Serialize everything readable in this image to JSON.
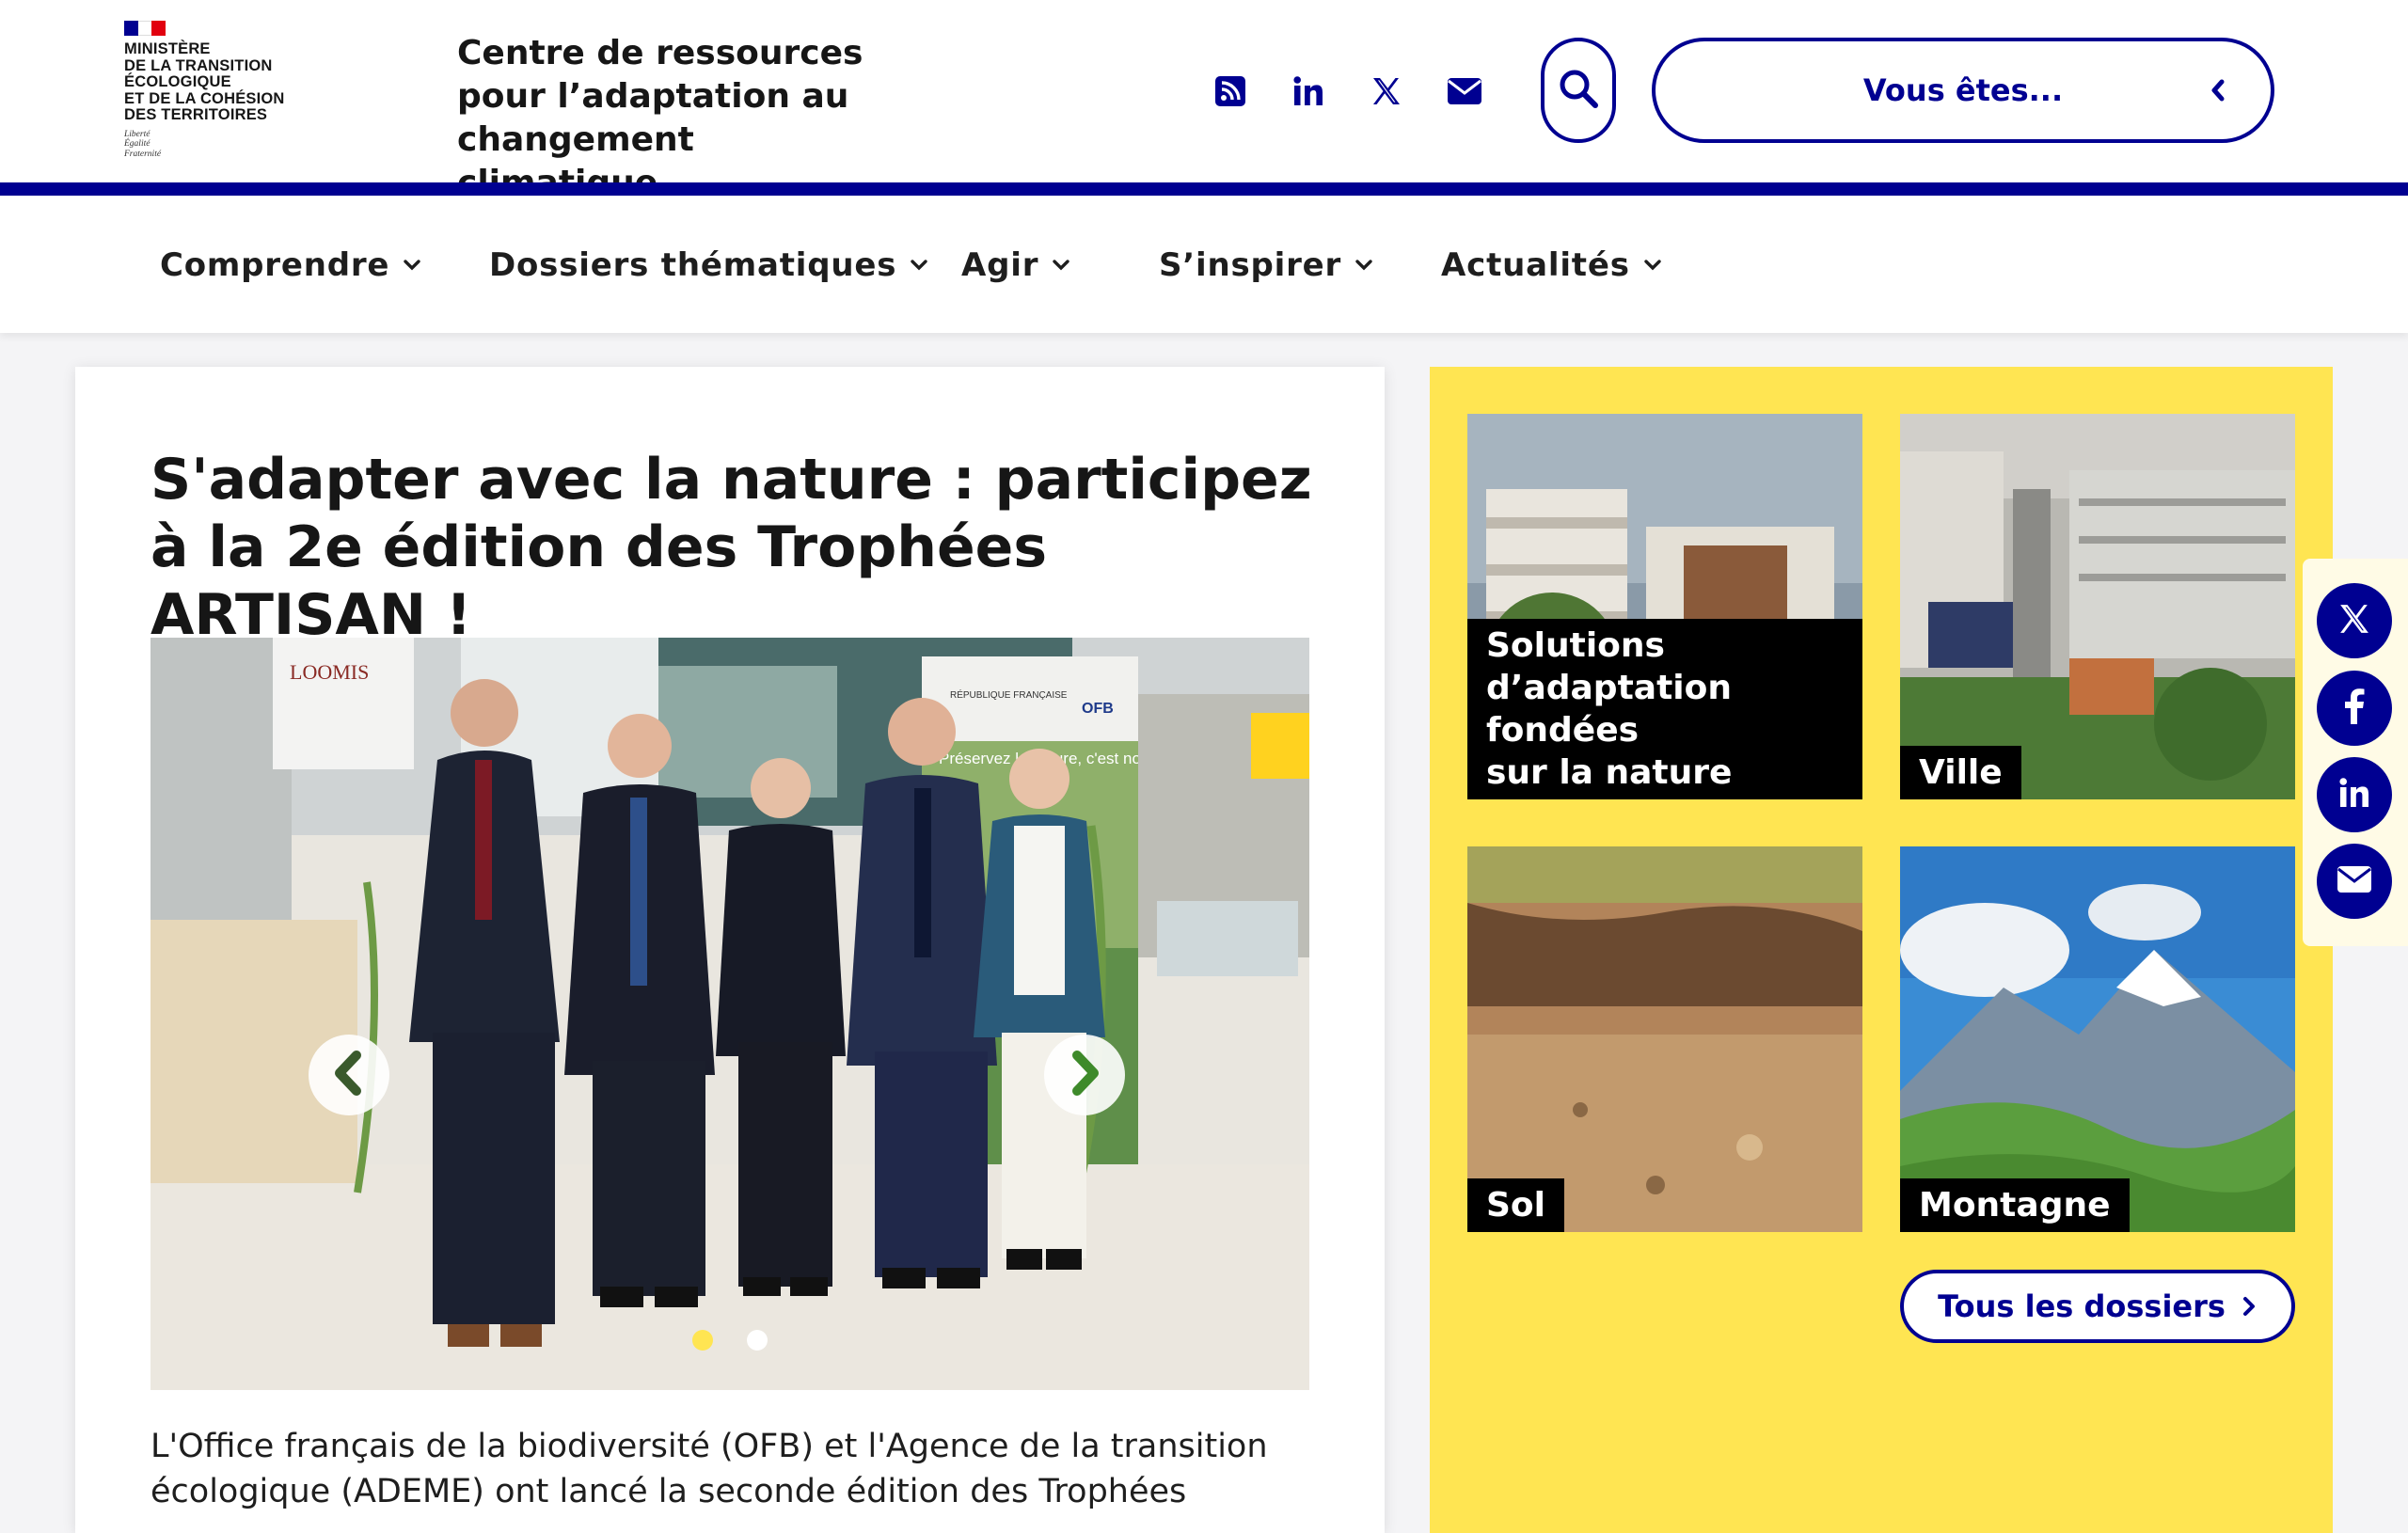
{
  "header": {
    "logo": {
      "lines": [
        "MINISTÈRE",
        "DE LA TRANSITION",
        "ÉCOLOGIQUE",
        "ET DE LA COHÉSION",
        "DES TERRITOIRES"
      ],
      "motto": [
        "Liberté",
        "Égalité",
        "Fraternité"
      ]
    },
    "site_title_lines": [
      "Centre de ressources",
      "pour l’adaptation au",
      "changement climatique"
    ],
    "social": [
      "rss-icon",
      "linkedin-icon",
      "x-icon",
      "envelope-icon"
    ],
    "search_icon": "search-icon",
    "vous_etes_label": "Vous êtes..."
  },
  "nav": {
    "items": [
      {
        "label": "Comprendre"
      },
      {
        "label": "Dossiers thématiques"
      },
      {
        "label": "Agir"
      },
      {
        "label": "S’inspirer"
      },
      {
        "label": "Actualités"
      }
    ]
  },
  "article": {
    "title": "S'adapter avec la nature : participez à la 2e édition des Trophées ARTISAN !",
    "intro": "L'Office français de la biodiversité (OFB) et l'Agence de la transition écologique (ADEME) ont lancé la seconde édition des Trophées",
    "carousel": {
      "slide_count": 2,
      "active_index": 0,
      "photo_signs": {
        "rf": "RÉPUBLIQUE FRANÇAISE",
        "ofb": "OFB",
        "banner": "Préservez la nature, c'est nous préserver",
        "brand": "LOOMIS"
      }
    }
  },
  "dossiers": {
    "tiles": [
      {
        "caption_lines": [
          "Solutions",
          "d’adaptation fondées",
          "sur la nature"
        ]
      },
      {
        "caption_lines": [
          "Ville"
        ]
      },
      {
        "caption_lines": [
          "Sol"
        ]
      },
      {
        "caption_lines": [
          "Montagne"
        ]
      }
    ],
    "all_label": "Tous les dossiers"
  },
  "share": [
    "x-icon",
    "facebook-icon",
    "linkedin-icon",
    "envelope-icon"
  ],
  "colors": {
    "primary_blue": "#000091",
    "panel_yellow": "#ffe552",
    "active_dot": "#ffe552",
    "caption_bg": "#000000"
  }
}
